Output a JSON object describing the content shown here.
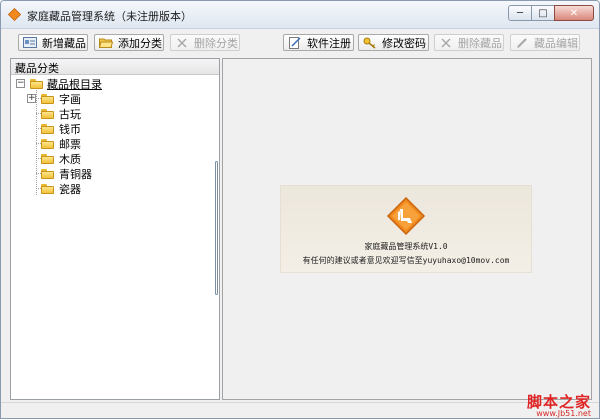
{
  "window": {
    "title": "家庭藏品管理系统（未注册版本）",
    "controls": {
      "minimize": "─",
      "maximize": "□",
      "close": "✕"
    }
  },
  "toolbar": {
    "add_item": "新增藏品",
    "add_category": "添加分类",
    "delete_category": "删除分类",
    "register": "软件注册",
    "change_password": "修改密码",
    "delete_item": "删除藏品",
    "edit_item": "藏品编辑"
  },
  "left_panel": {
    "header": "藏品分类",
    "root": {
      "label": "藏品根目录",
      "expander": "−"
    },
    "categories": [
      {
        "label": "字画",
        "expander": "+"
      },
      {
        "label": "古玩"
      },
      {
        "label": "钱币"
      },
      {
        "label": "邮票"
      },
      {
        "label": "木质"
      },
      {
        "label": "青铜器"
      },
      {
        "label": "瓷器"
      }
    ]
  },
  "about": {
    "line1": "家庭藏品管理系统V1.0",
    "line2": "有任何的建议或者意见欢迎写信至yuyuhaxo@10mov.com"
  },
  "watermark": {
    "main": "脚本之家",
    "sub": "www.Jb51.net"
  },
  "colors": {
    "window_bg": "#f0f0f0",
    "about_bg": "#ece7dc",
    "logo_orange": "#f2891f",
    "watermark_red": "#e02424"
  }
}
